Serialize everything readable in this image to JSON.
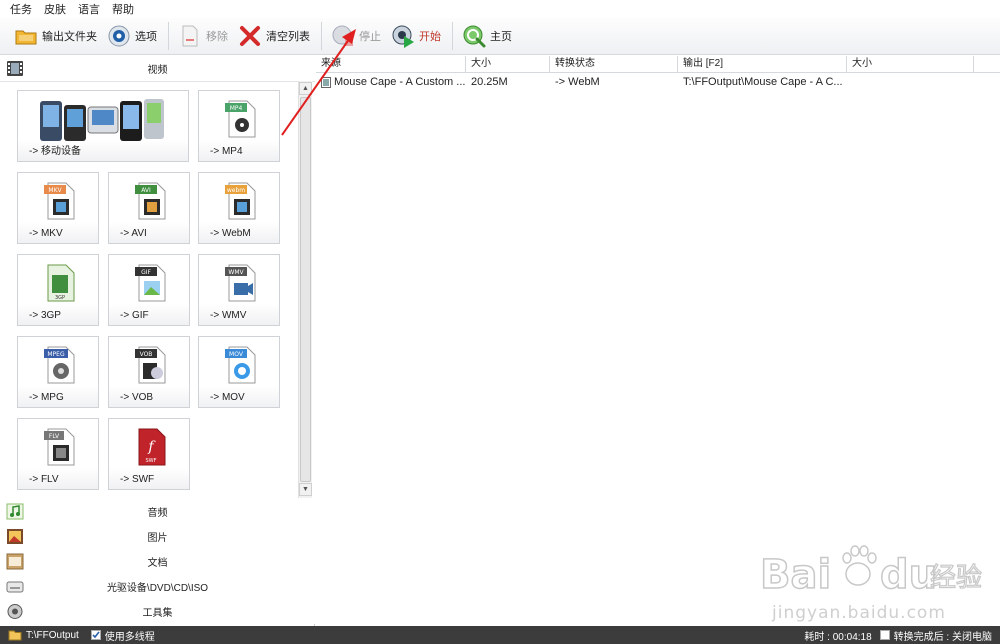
{
  "menu": [
    "任务",
    "皮肤",
    "语言",
    "帮助"
  ],
  "toolbar": {
    "output_folder": "输出文件夹",
    "options": "选项",
    "remove": "移除",
    "clear_list": "清空列表",
    "stop": "停止",
    "start": "开始",
    "home": "主页"
  },
  "left": {
    "video_label": "视频",
    "tiles": [
      {
        "label": "-> 移动设备",
        "badge": ""
      },
      {
        "label": "-> MP4",
        "badge": "MP4"
      },
      {
        "label": "-> MKV",
        "badge": "MKV"
      },
      {
        "label": "-> AVI",
        "badge": "AVI"
      },
      {
        "label": "-> WebM",
        "badge": "webm"
      },
      {
        "label": "-> 3GP",
        "badge": "3GP"
      },
      {
        "label": "-> GIF",
        "badge": "GIF"
      },
      {
        "label": "-> WMV",
        "badge": "WMV"
      },
      {
        "label": "-> MPG",
        "badge": "MPEG"
      },
      {
        "label": "-> VOB",
        "badge": "VOB"
      },
      {
        "label": "-> MOV",
        "badge": "MOV"
      },
      {
        "label": "-> FLV",
        "badge": "FLV"
      },
      {
        "label": "-> SWF",
        "badge": "SWF"
      }
    ],
    "categories": [
      "音频",
      "图片",
      "文档",
      "光驱设备\\DVD\\CD\\ISO",
      "工具集"
    ]
  },
  "table": {
    "columns": [
      "来源",
      "大小",
      "转换状态",
      "输出 [F2]",
      "大小"
    ],
    "rows": [
      {
        "source": "Mouse Cape - A Custom ...",
        "size": "20.25M",
        "status": "-> WebM",
        "output": "T:\\FFOutput\\Mouse Cape - A C...",
        "out_size": ""
      }
    ]
  },
  "status": {
    "output_path": "T:\\FFOutput",
    "multithread": "使用多线程",
    "elapsed": "耗时 : 00:04:18",
    "after_done": "转换完成后 : 关闭电脑"
  },
  "watermark": {
    "brand": "Bai",
    "brand2": "du",
    "cn": "经验",
    "url": "jingyan.baidu.com"
  },
  "colors": {
    "accent_start": "#c0392b",
    "status_bar": "#3c3c3c",
    "arrow": "#e02020"
  }
}
